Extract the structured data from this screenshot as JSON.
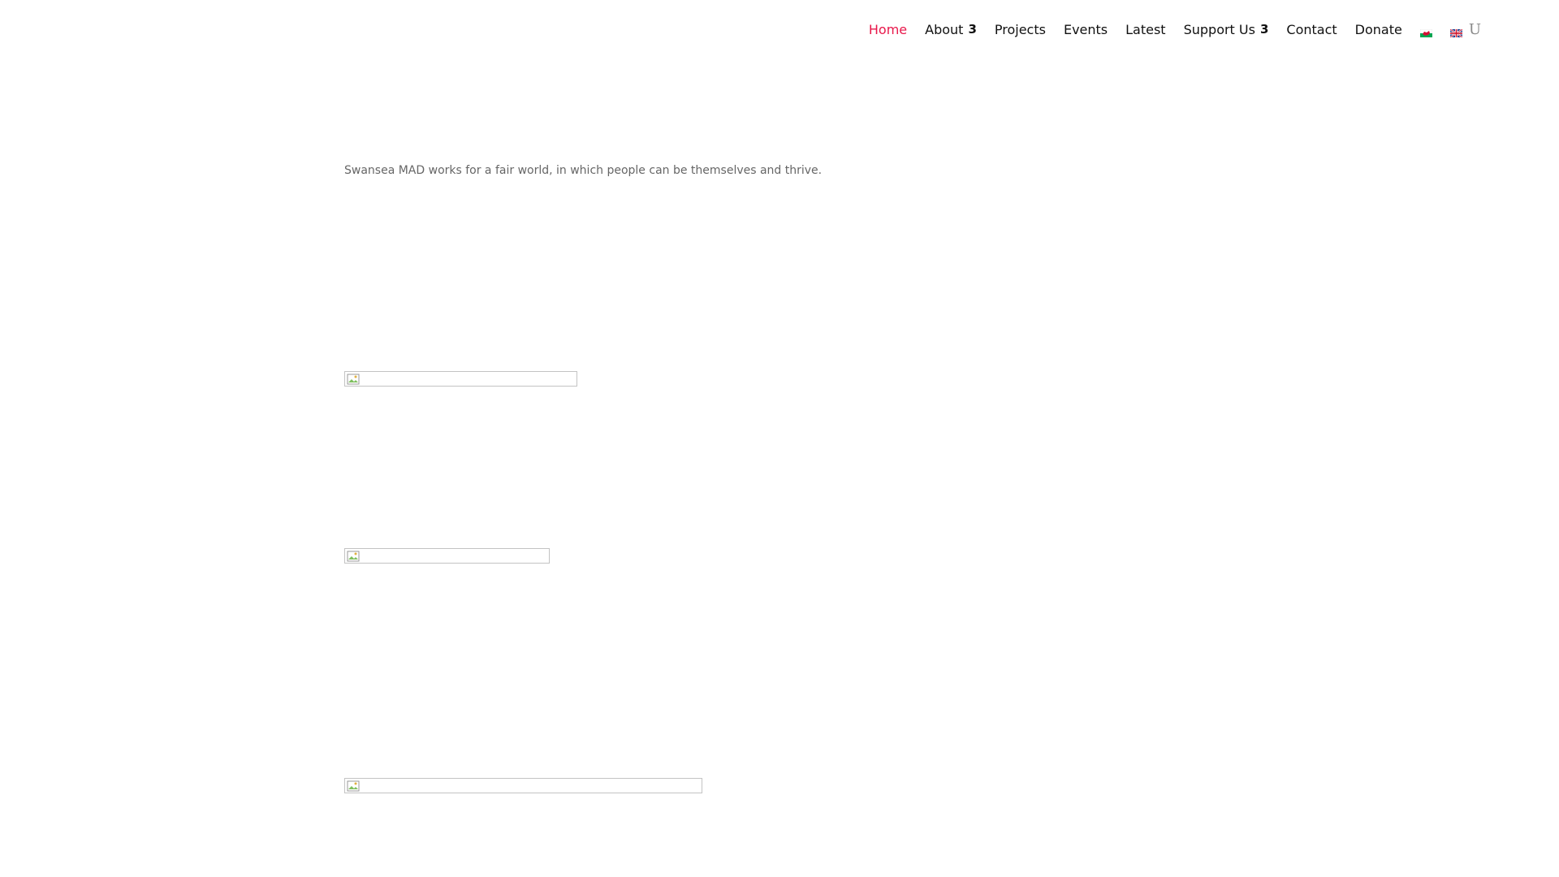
{
  "nav": {
    "items": [
      {
        "label": "Home",
        "active": true
      },
      {
        "label": "About",
        "has_submenu": true,
        "submenu_glyph": "3"
      },
      {
        "label": "Projects"
      },
      {
        "label": "Events"
      },
      {
        "label": "Latest"
      },
      {
        "label": "Support Us",
        "has_submenu": true,
        "submenu_glyph": "3"
      },
      {
        "label": "Contact"
      },
      {
        "label": "Donate"
      }
    ],
    "language_flags": [
      "welsh-flag-icon",
      "uk-flag-icon"
    ],
    "search_glyph": "U",
    "active_color": "#e8174a"
  },
  "main": {
    "intro_text": "Swansea MAD works for a fair world, in which people can be themselves and thrive."
  },
  "images": [
    "broken-image-icon",
    "broken-image-icon",
    "broken-image-icon"
  ]
}
